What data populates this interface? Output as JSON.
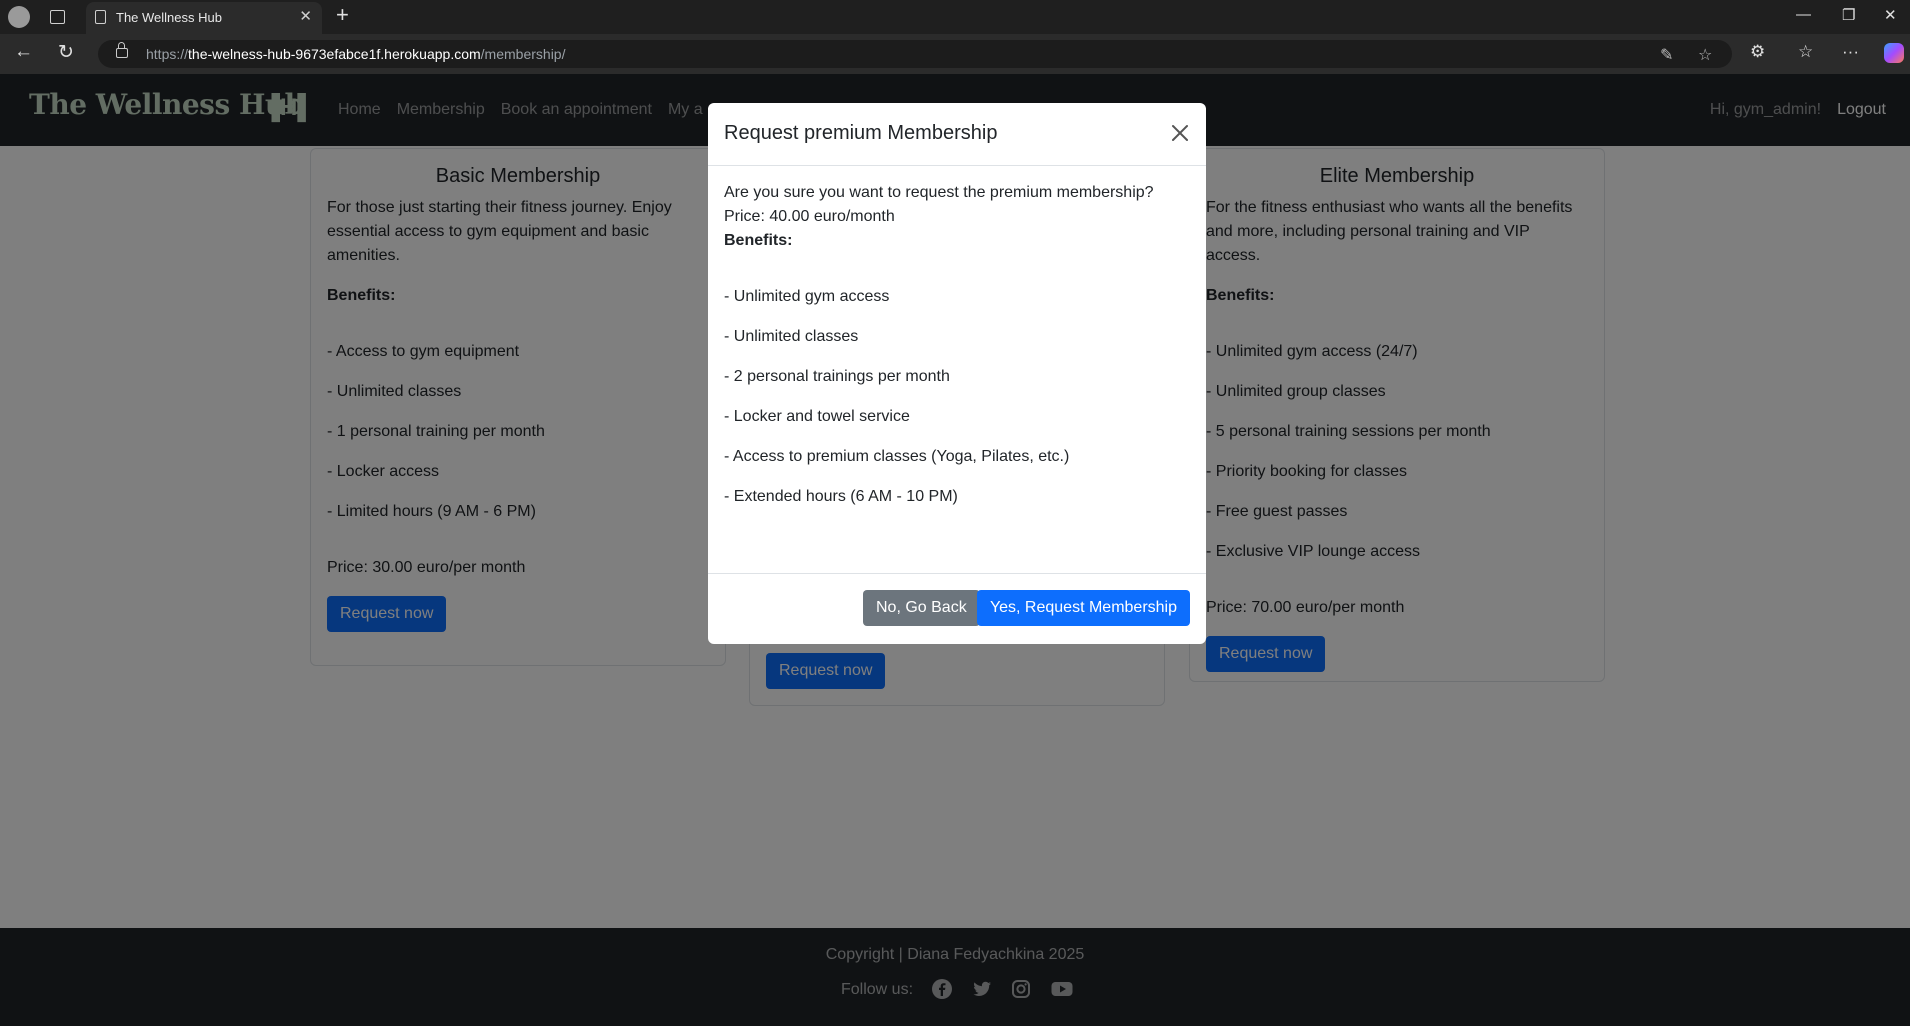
{
  "browser": {
    "tab_title": "The Wellness Hub",
    "url_prefix": "https://",
    "url_host": "the-welness-hub-9673efabce1f.herokuapp.com",
    "url_path": "/membership/"
  },
  "nav": {
    "brand": "The Wellness Hub",
    "brand_mark": "▐H▌",
    "links": [
      "Home",
      "Membership",
      "Book an appointment",
      "My a"
    ],
    "greeting": "Hi, gym_admin!",
    "logout": "Logout"
  },
  "cards": {
    "basic": {
      "title": "Basic Membership",
      "description": "For those just starting their fitness journey. Enjoy essential access to gym equipment and basic amenities.",
      "benefits_title": "Benefits:",
      "benefits": [
        "- Access to gym equipment",
        "- Unlimited classes",
        "- 1 personal training per month",
        "- Locker access",
        "- Limited hours (9 AM - 6 PM)"
      ],
      "price": "Price: 30.00 euro/per month",
      "button": "Request now"
    },
    "premium": {
      "button": "Request now"
    },
    "elite": {
      "title": "Elite Membership",
      "description": "For the fitness enthusiast who wants all the benefits and more, including personal training and VIP access.",
      "benefits_title": "Benefits:",
      "benefits": [
        "- Unlimited gym access (24/7)",
        "- Unlimited group classes",
        "- 5 personal training sessions per month",
        "- Priority booking for classes",
        "- Free guest passes",
        "- Exclusive VIP lounge access"
      ],
      "price": "Price: 70.00 euro/per month",
      "button": "Request now"
    }
  },
  "modal": {
    "title": "Request premium Membership",
    "question": "Are you sure you want to request the premium membership?",
    "price": "Price: 40.00 euro/month",
    "benefits_title": "Benefits:",
    "benefits": [
      "- Unlimited gym access",
      "- Unlimited classes",
      "- 2 personal trainings per month",
      "- Locker and towel service",
      "- Access to premium classes (Yoga, Pilates, etc.)",
      "- Extended hours (6 AM - 10 PM)"
    ],
    "cancel_label": "No, Go Back",
    "confirm_label": "Yes, Request Membership"
  },
  "footer": {
    "copyright": "Copyright | Diana Fedyachkina 2025",
    "follow": "Follow us:",
    "social_icons": [
      "facebook-icon",
      "twitter-icon",
      "instagram-icon",
      "youtube-icon"
    ]
  },
  "colors": {
    "primary": "#0d6efd",
    "secondary": "#6c757d",
    "navbar": "#212529",
    "brand": "#c7dbc6"
  }
}
